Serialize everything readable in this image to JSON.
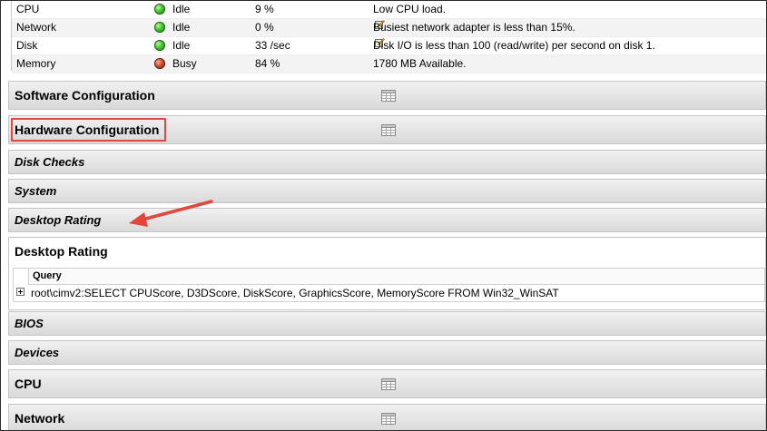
{
  "resources": [
    {
      "name": "CPU",
      "status": "Idle",
      "status_color": "#3fbf2a",
      "value": "9 %",
      "description": "Low CPU load.",
      "editable": false
    },
    {
      "name": "Network",
      "status": "Idle",
      "status_color": "#3fbf2a",
      "value": "0 %",
      "description": "Busiest network adapter is less than 15%.",
      "editable": true
    },
    {
      "name": "Disk",
      "status": "Idle",
      "status_color": "#3fbf2a",
      "value": "33 /sec",
      "description": "Disk I/O is less than 100 (read/write) per second on disk 1.",
      "editable": true
    },
    {
      "name": "Memory",
      "status": "Busy",
      "status_color": "#c74b2e",
      "value": "84 %",
      "description": "1780 MB Available.",
      "editable": false
    }
  ],
  "sections": {
    "software_configuration": "Software Configuration",
    "hardware_configuration": "Hardware Configuration",
    "disk_checks": "Disk Checks",
    "system": "System",
    "desktop_rating": "Desktop Rating",
    "bios": "BIOS",
    "devices": "Devices",
    "cpu": "CPU",
    "network": "Network"
  },
  "desktop_rating_panel": {
    "title": "Desktop Rating",
    "column_header": "Query",
    "query": "root\\cimv2:SELECT CPUScore, D3DScore, DiskScore, GraphicsScore, MemoryScore FROM Win32_WinSAT"
  },
  "colors": {
    "highlight_box": "#e2463d",
    "annotation_arrow": "#e2463d"
  },
  "icons": {
    "section_toggle": "table-grid-icon",
    "edit": "edit-note-icon",
    "expand": "plus-box-icon"
  }
}
